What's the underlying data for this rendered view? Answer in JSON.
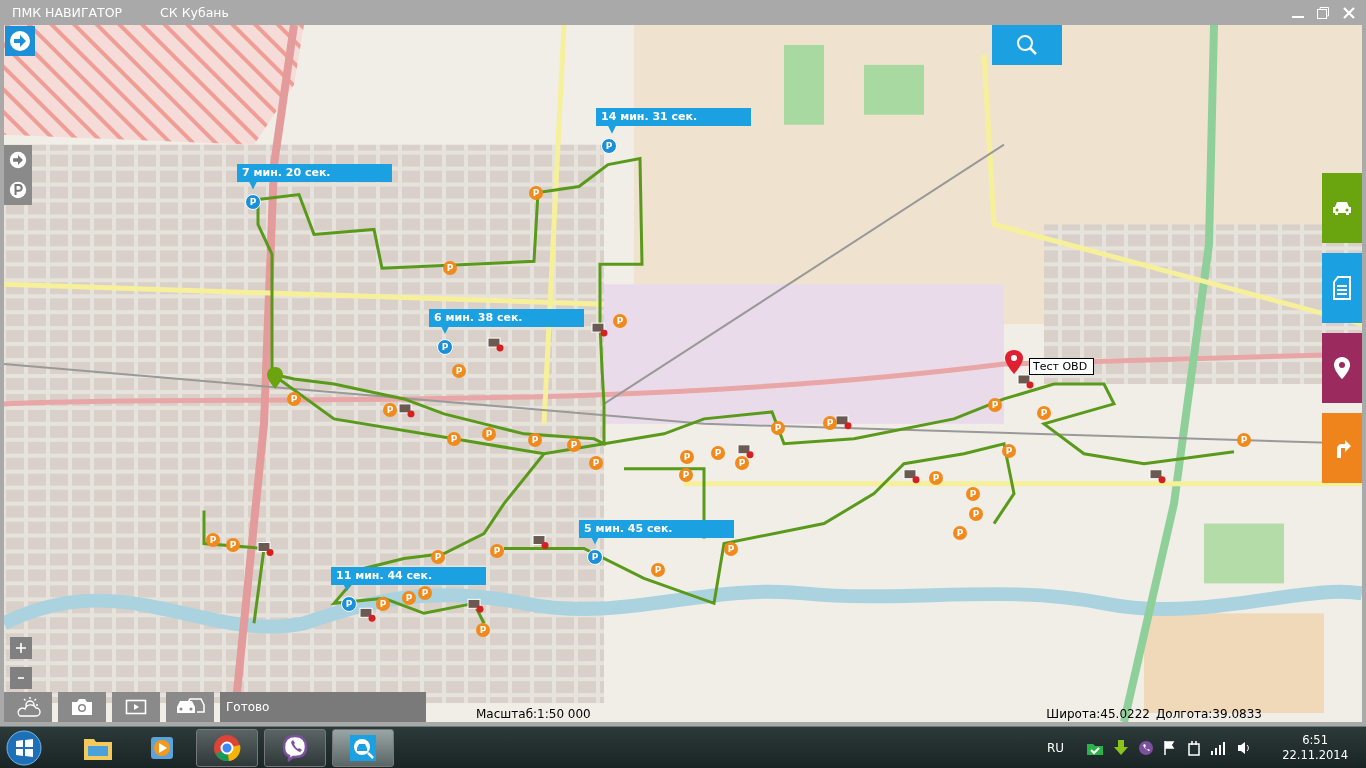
{
  "window": {
    "title": "ПМК НАВИГАТОР",
    "subtitle": "СК Кубань"
  },
  "map": {
    "route_labels": [
      {
        "text": "14 мин. 31 сек.",
        "pin": "P"
      },
      {
        "text": "7 мин. 20 сек.",
        "pin": "P"
      },
      {
        "text": "6 мин. 38 сек.",
        "pin": "P"
      },
      {
        "text": "5 мин. 45 сек.",
        "pin": "P"
      },
      {
        "text": "11 мин. 44 сек.",
        "pin": "P"
      }
    ],
    "parking_markers": [
      {
        "sign": "P"
      },
      {
        "sign": "P"
      },
      {
        "sign": "P"
      },
      {
        "sign": "P"
      },
      {
        "sign": "P"
      },
      {
        "sign": "P"
      },
      {
        "sign": "P"
      },
      {
        "sign": "P"
      },
      {
        "sign": "P"
      },
      {
        "sign": "P"
      },
      {
        "sign": "P"
      },
      {
        "sign": "P"
      },
      {
        "sign": "P"
      },
      {
        "sign": "P"
      },
      {
        "sign": "P"
      },
      {
        "sign": "P"
      },
      {
        "sign": "P"
      },
      {
        "sign": "P"
      },
      {
        "sign": "P"
      },
      {
        "sign": "P"
      },
      {
        "sign": "P"
      },
      {
        "sign": "P"
      },
      {
        "sign": "P"
      },
      {
        "sign": "P"
      },
      {
        "sign": "P"
      },
      {
        "sign": "P"
      },
      {
        "sign": "P"
      },
      {
        "sign": "P"
      },
      {
        "sign": "P"
      },
      {
        "sign": "P"
      },
      {
        "sign": "P"
      },
      {
        "sign": "P"
      },
      {
        "sign": "P"
      },
      {
        "sign": "P"
      },
      {
        "sign": "P"
      }
    ],
    "vehicle_label": "Тест OBD",
    "scale": "Масштаб:1:50 000",
    "latitude": "Широта:45.0222",
    "longitude": "Долгота:39.0833"
  },
  "status": "Готово",
  "taskbar": {
    "language": "RU",
    "time": "6:51",
    "date": "22.11.2014"
  }
}
